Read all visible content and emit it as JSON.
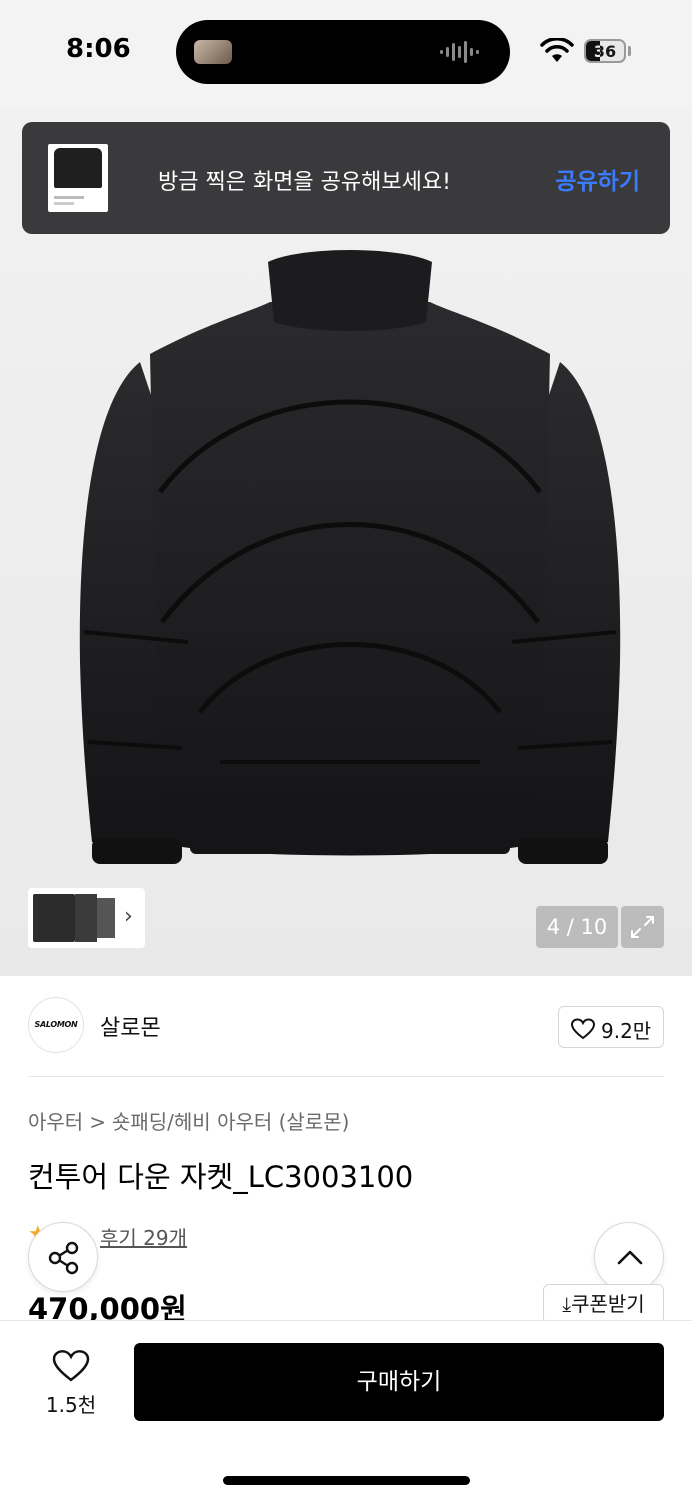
{
  "status_bar": {
    "time": "8:06",
    "battery": "36",
    "battery_level": 0.36
  },
  "share_toast": {
    "message": "방금 찍은 화면을 공유해보세요!",
    "action": "공유하기"
  },
  "gallery": {
    "current": "4 / 10"
  },
  "brand": {
    "logo_text": "SALOMON",
    "name": "살로몬",
    "likes": "9.2만"
  },
  "breadcrumb": {
    "level1": "아우터",
    "separator": ">",
    "level2": "숏패딩/헤비 아우터 (살로몬)"
  },
  "product": {
    "title": "컨투어 다운 자켓_LC3003100",
    "reviews": "후기 29개",
    "price": "470,000원",
    "coupon_label": "쿠폰받기"
  },
  "bottom_bar": {
    "like_count": "1.5천",
    "buy_label": "구매하기"
  },
  "colors": {
    "accent": "#3b7cff",
    "buy_button": "#000000",
    "toast_bg": "#3a3a3c"
  },
  "icons": [
    "wifi-icon",
    "battery-icon",
    "expand-icon",
    "heart-icon",
    "share-icon",
    "chevron-up-icon",
    "download-icon",
    "chevron-right-icon"
  ]
}
